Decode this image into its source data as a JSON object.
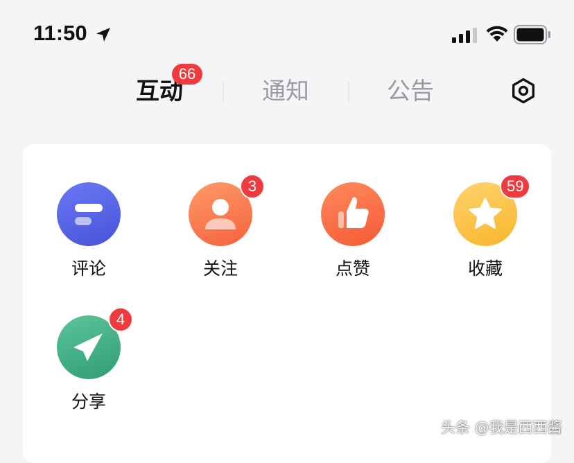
{
  "status_bar": {
    "time": "11:50",
    "location_icon": "location-arrow-icon",
    "signal_icon": "cellular-signal-icon",
    "wifi_icon": "wifi-icon",
    "battery_icon": "battery-icon"
  },
  "tabs": [
    {
      "label": "互动",
      "active": true,
      "badge": "66"
    },
    {
      "label": "通知",
      "active": false
    },
    {
      "label": "公告",
      "active": false
    }
  ],
  "settings_icon": "settings-icon",
  "items": [
    {
      "label": "评论",
      "icon": "comment-icon",
      "color": "#5a67e8"
    },
    {
      "label": "关注",
      "icon": "follow-user-icon",
      "color": "#f7784a",
      "badge": "3"
    },
    {
      "label": "点赞",
      "icon": "thumbs-up-icon",
      "color": "#f76a44"
    },
    {
      "label": "收藏",
      "icon": "star-icon",
      "color": "#fbc34a",
      "badge": "59"
    },
    {
      "label": "分享",
      "icon": "share-paper-plane-icon",
      "color": "#43b386",
      "badge": "4"
    }
  ],
  "badge_color": "#ef3b3f",
  "watermark": "头条 @我是西西酱"
}
